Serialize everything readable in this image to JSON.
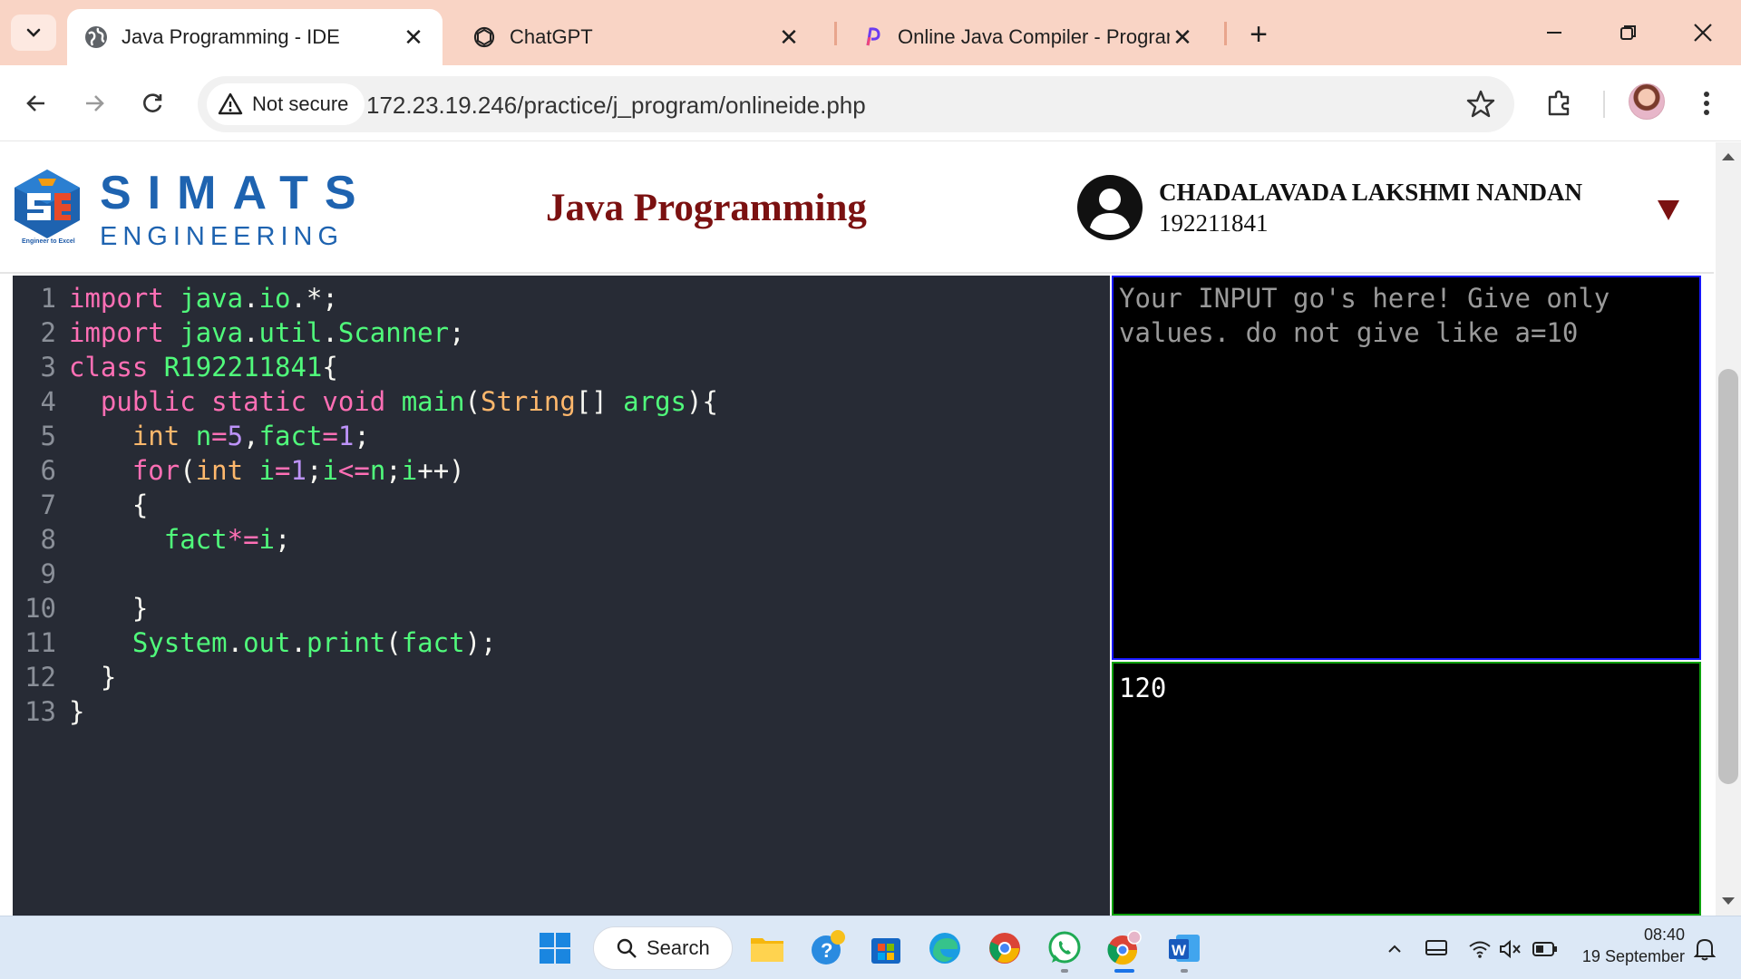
{
  "browser": {
    "tabs": [
      {
        "title": "Java Programming - IDE",
        "active": true
      },
      {
        "title": "ChatGPT",
        "active": false
      },
      {
        "title": "Online Java Compiler - Program",
        "active": false
      }
    ],
    "security_label": "Not secure",
    "url": "172.23.19.246/practice/j_program/onlineide.php"
  },
  "header": {
    "logo_top": "SIMATS",
    "logo_bottom": "ENGINEERING",
    "logo_tagline": "Engineer to Excel",
    "title": "Java Programming",
    "user_name": "CHADALAVADA LAKSHMI NANDAN",
    "user_id": "192211841"
  },
  "editor": {
    "line_numbers": [
      "1",
      "2",
      "3",
      "4",
      "5",
      "6",
      "7",
      "8",
      "9",
      "10",
      "11",
      "12",
      "13"
    ],
    "code": [
      "import java.io.*;",
      "import java.util.Scanner;",
      "class R192211841{",
      "  public static void main(String[] args){",
      "    int n=5,fact=1;",
      "    for(int i=1;i<=n;i++)",
      "    {",
      "      fact*=i;",
      "",
      "    }",
      "    System.out.print(fact);",
      "  }",
      "}"
    ]
  },
  "input_panel": {
    "placeholder": "Your INPUT go's here! Give only values. do not give like a=10"
  },
  "output_panel": {
    "text": "120"
  },
  "taskbar": {
    "search_label": "Search",
    "time": "08:40",
    "date": "19 September"
  },
  "colors": {
    "tabbar_bg": "#f9d4c5",
    "title_color": "#7b1111",
    "logo_blue": "#1e63b0",
    "editor_bg": "#272b35",
    "input_border": "#1717ff",
    "output_border": "#0ea10e",
    "taskbar_bg": "#dce8f6"
  }
}
